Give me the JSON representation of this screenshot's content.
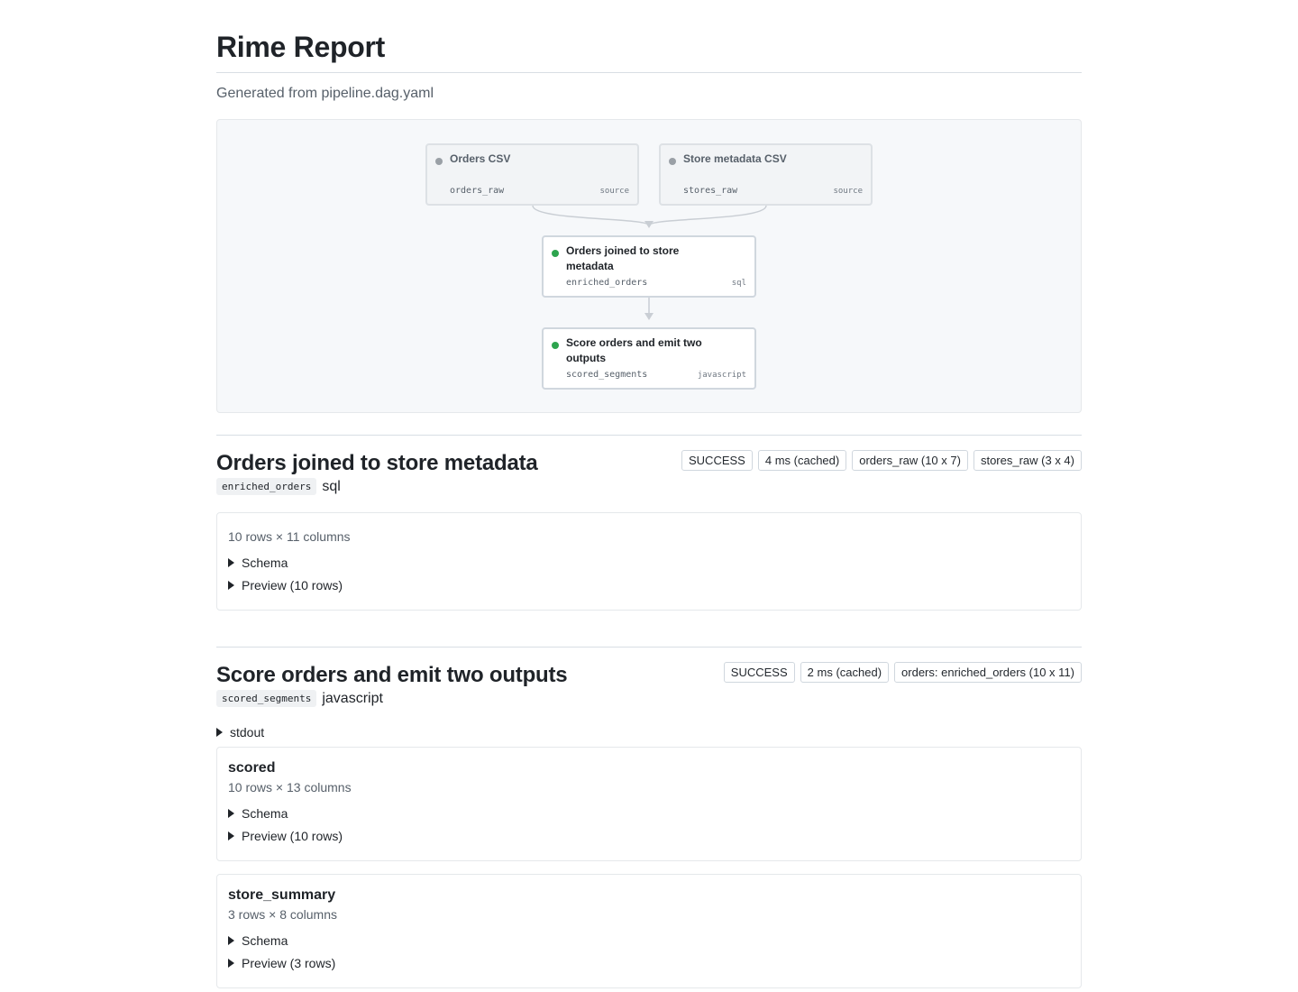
{
  "report": {
    "title": "Rime Report",
    "subtitle": "Generated from pipeline.dag.yaml"
  },
  "dag": {
    "nodes": [
      {
        "label": "Orders CSV",
        "id": "orders_raw",
        "kind": "source"
      },
      {
        "label": "Store metadata CSV",
        "id": "stores_raw",
        "kind": "source"
      },
      {
        "label": "Orders joined to store metadata",
        "id": "enriched_orders",
        "kind": "sql"
      },
      {
        "label": "Score orders and emit two outputs",
        "id": "scored_segments",
        "kind": "javascript"
      }
    ]
  },
  "steps": [
    {
      "title": "Orders joined to store metadata",
      "id": "enriched_orders",
      "kind": "sql",
      "badges": [
        "SUCCESS",
        "4 ms (cached)",
        "orders_raw (10 x 7)",
        "stores_raw (3 x 4)"
      ],
      "output": {
        "shape": "10 rows × 11 columns",
        "schema_label": "Schema",
        "preview_label": "Preview (10 rows)"
      }
    },
    {
      "title": "Score orders and emit two outputs",
      "id": "scored_segments",
      "kind": "javascript",
      "badges": [
        "SUCCESS",
        "2 ms (cached)",
        "orders: enriched_orders (10 x 11)"
      ],
      "stdout_label": "stdout",
      "outputs": [
        {
          "name": "scored",
          "shape": "10 rows × 13 columns",
          "schema_label": "Schema",
          "preview_label": "Preview (10 rows)"
        },
        {
          "name": "store_summary",
          "shape": "3 rows × 8 columns",
          "schema_label": "Schema",
          "preview_label": "Preview (3 rows)"
        }
      ]
    }
  ]
}
